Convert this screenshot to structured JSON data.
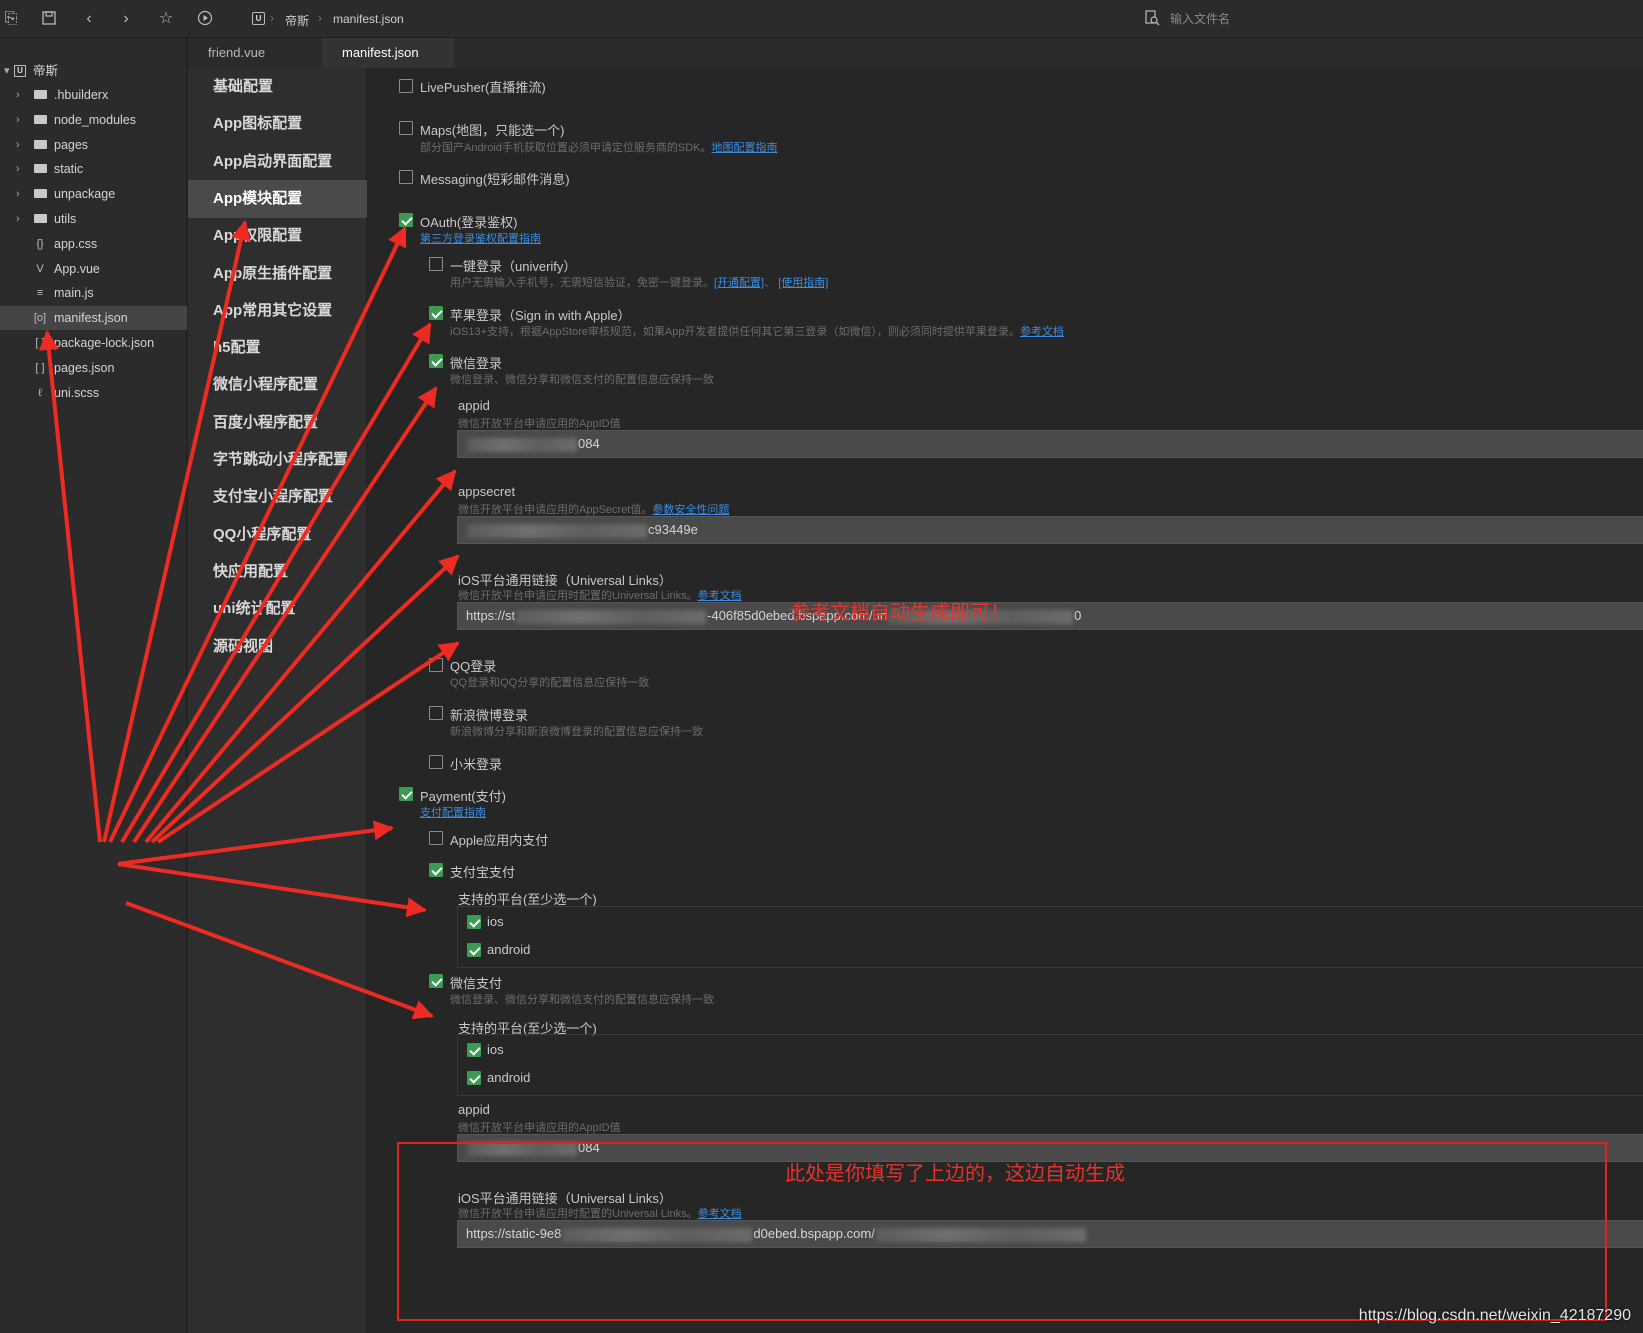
{
  "toolbar": {
    "breadcrumb_project": "帝斯",
    "breadcrumb_file": "manifest.json",
    "project_badge": "U",
    "search_placeholder": "输入文件名"
  },
  "tree": {
    "project": "帝斯",
    "items": [
      {
        "label": ".hbuilderx",
        "kind": "folder"
      },
      {
        "label": "node_modules",
        "kind": "folder"
      },
      {
        "label": "pages",
        "kind": "folder"
      },
      {
        "label": "static",
        "kind": "folder"
      },
      {
        "label": "unpackage",
        "kind": "folder"
      },
      {
        "label": "utils",
        "kind": "folder"
      },
      {
        "label": "app.css",
        "kind": "file",
        "icon": "{}"
      },
      {
        "label": "App.vue",
        "kind": "file",
        "icon": "V"
      },
      {
        "label": "main.js",
        "kind": "file",
        "icon": "≡"
      },
      {
        "label": "manifest.json",
        "kind": "file",
        "icon": "[o]"
      },
      {
        "label": "package-lock.json",
        "kind": "file",
        "icon": "[ ]"
      },
      {
        "label": "pages.json",
        "kind": "file",
        "icon": "[ ]"
      },
      {
        "label": "uni.scss",
        "kind": "file",
        "icon": "ℓ"
      }
    ]
  },
  "tabs": [
    "friend.vue",
    "manifest.json"
  ],
  "config_nav": [
    "基础配置",
    "App图标配置",
    "App启动界面配置",
    "App模块配置",
    "App权限配置",
    "App原生插件配置",
    "App常用其它设置",
    "h5配置",
    "微信小程序配置",
    "百度小程序配置",
    "字节跳动小程序配置",
    "支付宝小程序配置",
    "QQ小程序配置",
    "快应用配置",
    "uni统计配置",
    "源码视图"
  ],
  "modules": {
    "livepusher": "LivePusher(直播推流)",
    "maps": "Maps(地图，只能选一个)",
    "maps_desc": "部分国产Android手机获取位置必须申请定位服务商的SDK。",
    "maps_link": "地图配置指南",
    "messaging": "Messaging(短彩邮件消息)",
    "oauth": "OAuth(登录鉴权)",
    "oauth_link": "第三方登录鉴权配置指南",
    "univerify": "一键登录（univerify）",
    "univerify_desc": "用户无需输入手机号，无需短信验证，免密一键登录。",
    "univerify_link1": "[开通配置]",
    "univerify_sep": "、",
    "univerify_link2": "[使用指南]",
    "apple": "苹果登录（Sign in with Apple）",
    "apple_desc": "iOS13+支持，根据AppStore审核规范，如果App开发者提供任何其它第三登录（如微信），则必须同时提供苹果登录。",
    "apple_link": "参考文档",
    "weixin_login": "微信登录",
    "weixin_login_desc": "微信登录、微信分享和微信支付的配置信息应保持一致",
    "appid_label": "appid",
    "appid_desc": "微信开放平台申请应用的AppID值",
    "appid_value": "084",
    "appsecret_label": "appsecret",
    "appsecret_desc": "微信开放平台申请应用的AppSecret值。",
    "appsecret_link": "参数安全性问题",
    "appsecret_value": "c93449e",
    "ul_label": "iOS平台通用链接（Universal Links）",
    "ul_desc": "微信开放平台申请应用时配置的Universal Links。",
    "ul_link": "参考文档",
    "ul_value_a": "https://st",
    "ul_value_b": "-406f85d0ebed.bspapp.com/un",
    "ul_value_c": "0",
    "qq": "QQ登录",
    "qq_desc": "QQ登录和QQ分享的配置信息应保持一致",
    "sina": "新浪微博登录",
    "sina_desc": "新浪微博分享和新浪微博登录的配置信息应保持一致",
    "xiaomi": "小米登录",
    "payment": "Payment(支付)",
    "payment_link": "支付配置指南",
    "apple_pay": "Apple应用内支付",
    "alipay": "支付宝支付",
    "platforms_label": "支持的平台(至少选一个)",
    "ios": "ios",
    "android": "android",
    "wxpay": "微信支付",
    "wxpay_desc": "微信登录、微信分享和微信支付的配置信息应保持一致",
    "wxpay_appid_value": "084",
    "wxpay_ul_a": "https://static-9e8",
    "wxpay_ul_b": "d0ebed.bspapp.com/"
  },
  "annotations": {
    "note1": "参考文档自动生成即可！",
    "note2": "此处是你填写了上边的，这边自动生成",
    "watermark": "https://blog.csdn.net/weixin_42187290",
    "color": "#e8322a"
  }
}
